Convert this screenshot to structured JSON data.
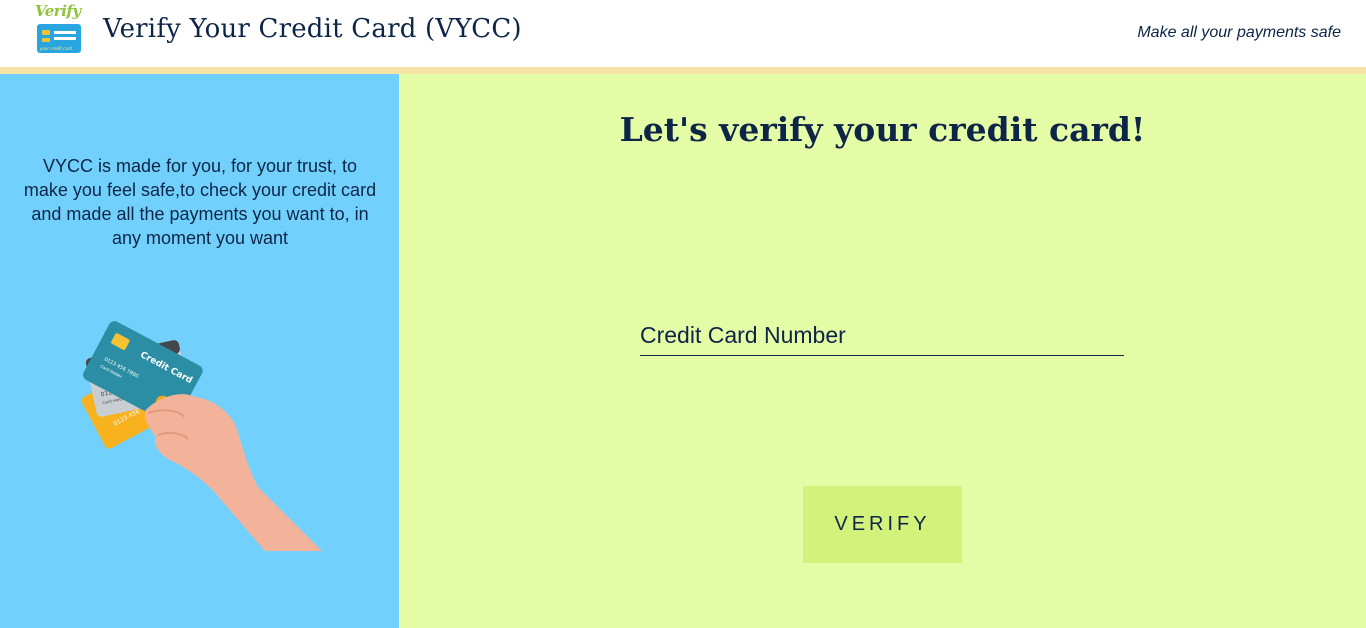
{
  "header": {
    "logo_script": "Verify",
    "logo_tagline": "your credit card",
    "title": "Verify Your Credit Card (VYCC)",
    "tagline": "Make all your payments safe"
  },
  "sidebar": {
    "intro_text": "VYCC is made for you, for your trust, to make you feel safe,to check your credit card and made all the payments you want to, in any moment you want",
    "cards": {
      "front_title": "Credit Card",
      "card_number": "0123 456 7890",
      "card_holder": "Card Holder"
    }
  },
  "main": {
    "heading": "Let's verify your credit card!",
    "card_field_label": "Credit Card Number",
    "verify_button": "VERIFY"
  },
  "colors": {
    "left_panel": "#72d1fc",
    "right_panel": "#e4fca6",
    "button": "#d3f27c",
    "header_stripe": "#f6e3a6",
    "text": "#0d2547"
  }
}
